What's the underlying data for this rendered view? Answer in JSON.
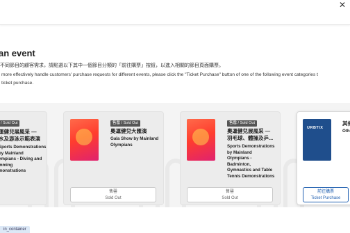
{
  "header": {
    "close_glyph": "✕"
  },
  "page": {
    "heading": "an event",
    "intro_zh": "不同節目的顧客需求，請點選以下其中一個節目分類的「前往購票」按鈕，以進入相關的節目頁面購票。",
    "intro_en_1": "more effectively handle customers' purchase requests for different events, please click the \"Ticket Purchase\" button of one of the following event categories t",
    "intro_en_2": "ticket purchase."
  },
  "cards": [
    {
      "tag": "/ Sold Out",
      "title_zh_1": "運健兒展風采 —",
      "title_zh_2": "水及游泳示範表演",
      "title_en": "Sports Demonstrations\nby Mainland\nympians - Diving and\nmming\nmonstrations",
      "button_zh": "",
      "button_en": ""
    },
    {
      "tag": "售罄 / Sold Out",
      "title_zh_1": "奧運健兒大匯演",
      "title_zh_2": "",
      "title_en": "Gala Show by Mainland\nOlympians",
      "button_zh": "售罄",
      "button_en": "Sold Out"
    },
    {
      "tag": "售罄 / Sold Out",
      "title_zh_1": "奧運健兒展風采 —",
      "title_zh_2": "羽毛球、體操及乒...",
      "title_en": "Sports Demonstrations\nby Mainland\nOlympians -\nBadminton,\nGymnastics and Table\nTennis Demonstrations",
      "button_zh": "售罄",
      "button_en": "Sold Out"
    },
    {
      "tag": "",
      "title_zh_1": "其他",
      "title_zh_2": "",
      "title_en": "Oth",
      "poster_text": "URBTIX",
      "button_zh": "前往購票",
      "button_en": "Ticket Purchase"
    }
  ],
  "status_bar": {
    "label": "in_container"
  },
  "colors": {
    "accent": "#1f5fb0",
    "tag_bg": "#555555",
    "band_bg": "#f4f4f4"
  },
  "icons": {
    "close": "close-icon"
  }
}
